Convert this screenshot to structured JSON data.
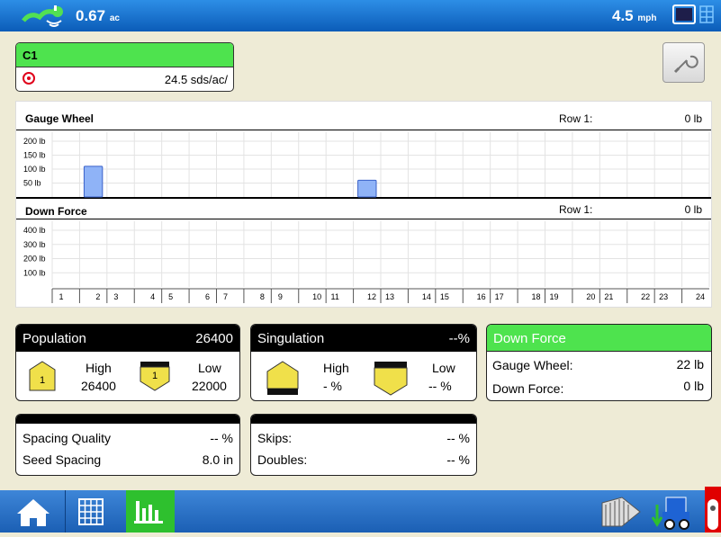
{
  "status_bar": {
    "area_value": "0.67",
    "area_unit": "ac",
    "speed_value": "4.5",
    "speed_unit": "mph"
  },
  "product": {
    "name": "C1",
    "rate": "24.5 sds/ac/"
  },
  "gauge_wheel_chart": {
    "title": "Gauge Wheel",
    "row_label": "Row 1:",
    "row_value": "0 lb",
    "y_ticks": [
      "200 lb",
      "150 lb",
      "100 lb",
      "50 lb"
    ]
  },
  "down_force_chart": {
    "title": "Down Force",
    "row_label": "Row 1:",
    "row_value": "0 lb",
    "y_ticks": [
      "400 lb",
      "300 lb",
      "200 lb",
      "100 lb"
    ]
  },
  "chart_data": [
    {
      "type": "bar",
      "title": "Gauge Wheel",
      "categories": [
        "1",
        "2",
        "3",
        "4",
        "5",
        "6",
        "7",
        "8",
        "9",
        "10",
        "11",
        "12",
        "13",
        "14",
        "15",
        "16",
        "17",
        "18",
        "19",
        "20",
        "21",
        "22",
        "23",
        "24"
      ],
      "values": [
        0,
        110,
        0,
        0,
        0,
        0,
        0,
        0,
        0,
        0,
        0,
        60,
        0,
        0,
        0,
        0,
        0,
        0,
        0,
        0,
        0,
        0,
        0,
        0
      ],
      "ylim": [
        0,
        200
      ]
    },
    {
      "type": "bar",
      "title": "Down Force",
      "categories": [
        "1",
        "2",
        "3",
        "4",
        "5",
        "6",
        "7",
        "8",
        "9",
        "10",
        "11",
        "12",
        "13",
        "14",
        "15",
        "16",
        "17",
        "18",
        "19",
        "20",
        "21",
        "22",
        "23",
        "24"
      ],
      "values": [
        0,
        0,
        0,
        0,
        0,
        0,
        0,
        0,
        0,
        0,
        0,
        0,
        0,
        0,
        0,
        0,
        0,
        0,
        0,
        0,
        0,
        0,
        0,
        0
      ],
      "ylim": [
        0,
        400
      ]
    }
  ],
  "population_box": {
    "title": "Population",
    "value": "26400",
    "high_label": "High",
    "high_value": "26400",
    "low_label": "Low",
    "low_value": "22000",
    "row_badge": "1"
  },
  "singulation_box": {
    "title": "Singulation",
    "value": "--%",
    "high_label": "High",
    "high_value": "- %",
    "low_label": "Low",
    "low_value": "-- %"
  },
  "down_force_box": {
    "title": "Down Force",
    "gauge_label": "Gauge Wheel:",
    "gauge_value": "22 lb",
    "force_label": "Down Force:",
    "force_value": "0 lb"
  },
  "spacing_box": {
    "quality_label": "Spacing Quality",
    "quality_value": "-- %",
    "spacing_label": "Seed Spacing",
    "spacing_value": "8.0 in"
  },
  "skips_box": {
    "skips_label": "Skips:",
    "skips_value": "-- %",
    "doubles_label": "Doubles:",
    "doubles_value": "-- %"
  },
  "icons": {
    "gps": "gps-satellite-icon",
    "display": "display-toggle-icon",
    "target": "target-icon",
    "wrench": "wrench-icon",
    "home": "home-icon",
    "grid": "grid-icon",
    "chart": "bar-chart-icon",
    "harvest": "field-operation-icon",
    "planter": "planter-icon"
  },
  "colors": {
    "accent_green": "#4ee34e",
    "bar_blue": "#8fb3f7",
    "top_bar_blue": "#1a6fd0",
    "active_tab_green": "#2ec02e"
  }
}
